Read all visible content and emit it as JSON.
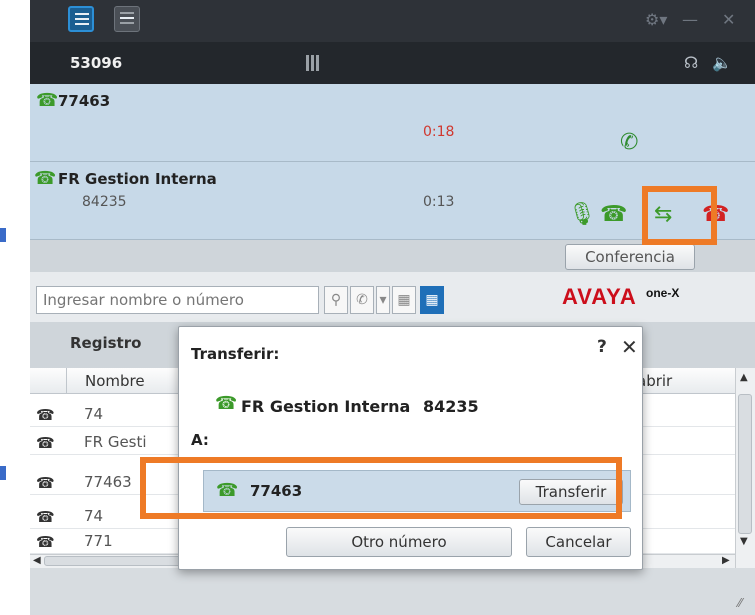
{
  "status": {
    "extension": "53096"
  },
  "calls": [
    {
      "name": "77463",
      "number": "",
      "time": "0:18"
    },
    {
      "name": "FR Gestion Interna",
      "number": "84235",
      "time": "0:13"
    }
  ],
  "conference_label": "Conferencia",
  "search": {
    "placeholder": "Ingresar nombre o número"
  },
  "logo": {
    "brand": "AVAYA",
    "product": "one-X"
  },
  "log": {
    "title": "Registro",
    "columns": [
      "Nombre",
      "abrir"
    ],
    "rows": [
      "74",
      "FR Gesti",
      "77463",
      "74",
      "771"
    ]
  },
  "dialog": {
    "title": "Transferir:",
    "help": "?",
    "from_name": "FR Gestion Interna",
    "from_number": "84235",
    "to_label": "A:",
    "target_number": "77463",
    "transfer_label": "Transferir",
    "other_label": "Otro número",
    "cancel_label": "Cancelar"
  },
  "colors": {
    "highlight": "#ee7a26",
    "accent_green": "#3c9a2a",
    "hangup_red": "#d22222",
    "timer_red": "#d0382f"
  }
}
